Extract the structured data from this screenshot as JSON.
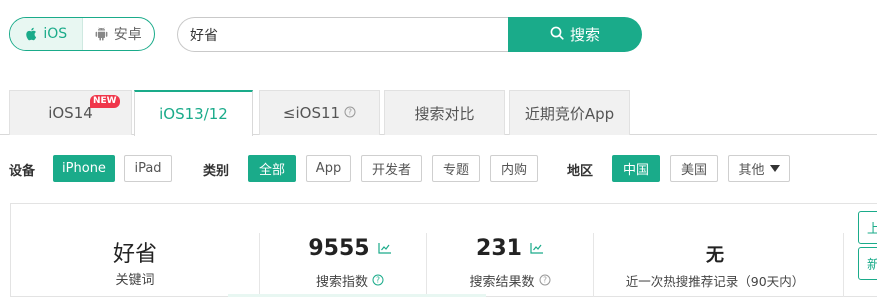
{
  "colors": {
    "accent": "#1aab8a",
    "badge": "#f0364a"
  },
  "platform": {
    "ios_label": "iOS",
    "android_label": "安卓",
    "ios_icon": "apple-icon",
    "android_icon": "android-icon"
  },
  "search": {
    "value": "好省",
    "button_label": "搜索",
    "button_icon": "search-icon"
  },
  "tabs": [
    {
      "label": "iOS14",
      "badge": "NEW"
    },
    {
      "label": "iOS13/12",
      "active": true
    },
    {
      "label": "≤iOS11",
      "icon": "question-circle-icon"
    },
    {
      "label": "搜索对比"
    },
    {
      "label": "近期竞价App"
    }
  ],
  "filters": {
    "device": {
      "label": "设备",
      "options": [
        "iPhone",
        "iPad"
      ],
      "selected": "iPhone"
    },
    "category": {
      "label": "类别",
      "options": [
        "全部",
        "App",
        "开发者",
        "专题",
        "内购"
      ],
      "selected": "全部"
    },
    "region": {
      "label": "地区",
      "options": [
        "中国",
        "美国"
      ],
      "more_label": "其他",
      "selected": "中国"
    }
  },
  "stats": {
    "keyword": {
      "value": "好省",
      "label": "关键词"
    },
    "search_index": {
      "value": "9555",
      "label": "搜索指数",
      "icon": "chart-icon"
    },
    "result_count": {
      "value": "231",
      "label": "搜索结果数",
      "icon": "chart-icon"
    },
    "hot_search": {
      "value": "无",
      "label": "近一次热搜推荐记录（90天内）"
    }
  },
  "side_buttons": [
    "上",
    "新"
  ]
}
